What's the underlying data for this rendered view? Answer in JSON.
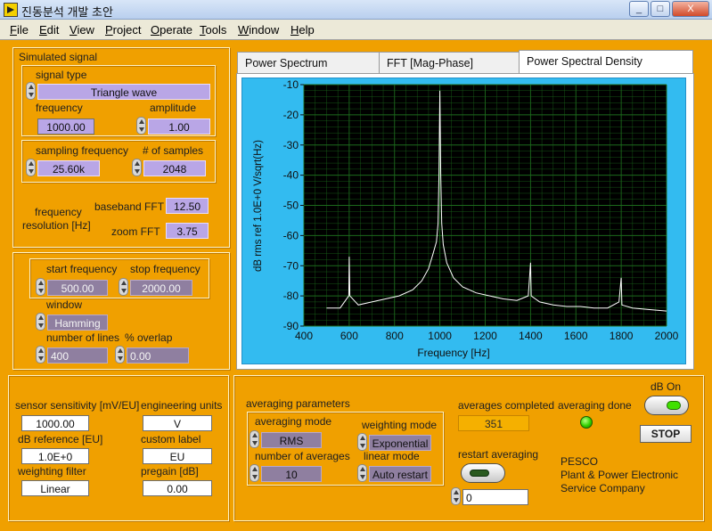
{
  "window": {
    "title": "진동분석 개발 초안",
    "minimize": "_",
    "maximize": "□",
    "close": "X"
  },
  "menu": [
    "File",
    "Edit",
    "View",
    "Project",
    "Operate",
    "Tools",
    "Window",
    "Help"
  ],
  "simulated": {
    "title": "Simulated signal",
    "signal_type_label": "signal type",
    "signal_type": "Triangle wave",
    "frequency_label": "frequency",
    "frequency": "1000.00",
    "amplitude_label": "amplitude",
    "amplitude": "1.00",
    "sampling_label": "sampling frequency",
    "sampling": "25.60k",
    "samples_label": "# of samples",
    "samples": "2048",
    "resolution_label_1": "frequency",
    "resolution_label_2": "resolution [Hz]",
    "baseband_label": "baseband FFT",
    "baseband": "12.50",
    "zoom_label": "zoom FFT",
    "zoom": "3.75"
  },
  "zoom_panel": {
    "start_label": "start frequency",
    "start": "500.00",
    "stop_label": "stop frequency",
    "stop": "2000.00",
    "window_label": "window",
    "window": "Hamming",
    "lines_label": "number of lines",
    "lines": "400",
    "overlap_label": "% overlap",
    "overlap": "0.00"
  },
  "sensor": {
    "sensitivity_label": "sensor sensitivity [mV/EU]",
    "sensitivity": "1000.00",
    "eng_units_label": "engineering units",
    "eng_units": "V",
    "dbref_label": "dB reference [EU]",
    "dbref": "1.0E+0",
    "custom_label_label": "custom label",
    "custom_label": "EU",
    "weighting_filter_label": "weighting filter",
    "weighting_filter": "Linear",
    "pregain_label": "pregain [dB]",
    "pregain": "0.00"
  },
  "averaging": {
    "title": "averaging parameters",
    "mode_label": "averaging mode",
    "mode": "RMS",
    "weighting_label": "weighting mode",
    "weighting": "Exponential",
    "num_label": "number of averages",
    "num": "10",
    "linear_label": "linear mode",
    "linear": "Auto restart",
    "completed_label": "averages completed",
    "completed": "351",
    "done_label": "averaging done",
    "restart_label": "restart averaging",
    "restart_value": "0",
    "db_on_label": "dB On",
    "stop_label": "STOP",
    "company_1": "PESCO",
    "company_2": "Plant & Power Electronic",
    "company_3": "Service Company"
  },
  "tabs": [
    "Power Spectrum",
    "FFT [Mag-Phase]",
    "Power Spectral Density"
  ],
  "colors": {
    "panel": "#f0a000",
    "plot_bg": "#000000",
    "grid": "#1c6a1c",
    "trace": "#ffffff",
    "frame": "#33bbf0",
    "led_on": "#30d000"
  },
  "chart_data": {
    "type": "line",
    "xlabel": "Frequency [Hz]",
    "ylabel": "dB rms ref 1.0E+0 V/sqrt(Hz)",
    "xlim": [
      400,
      2000
    ],
    "ylim": [
      -90,
      -10
    ],
    "x_ticks": [
      "400",
      "600",
      "800",
      "1000",
      "1200",
      "1400",
      "1600",
      "1800",
      "2000"
    ],
    "y_ticks": [
      "-10",
      "-20",
      "-30",
      "-40",
      "-50",
      "-60",
      "-70",
      "-80",
      "-90"
    ],
    "grid": true,
    "series": [
      {
        "x": [
          500,
          560,
          598,
          600,
          603,
          640,
          700,
          760,
          820,
          880,
          920,
          950,
          970,
          985,
          992,
          996,
          1000,
          1004,
          1008,
          1015,
          1030,
          1060,
          1100,
          1160,
          1220,
          1280,
          1340,
          1390,
          1400,
          1403,
          1440,
          1500,
          1560,
          1620,
          1680,
          1740,
          1790,
          1800,
          1803,
          1850,
          1920,
          2000
        ],
        "y": [
          -84,
          -84,
          -80,
          -67,
          -80,
          -83,
          -82,
          -81,
          -80,
          -78,
          -75,
          -71,
          -66,
          -62,
          -56,
          -40,
          -12,
          -40,
          -56,
          -63,
          -69,
          -74,
          -77,
          -79,
          -80,
          -81,
          -81.5,
          -80,
          -69,
          -80,
          -82,
          -83,
          -83.5,
          -83.5,
          -84,
          -84,
          -82,
          -74,
          -83,
          -84,
          -84.5,
          -85
        ]
      }
    ]
  }
}
